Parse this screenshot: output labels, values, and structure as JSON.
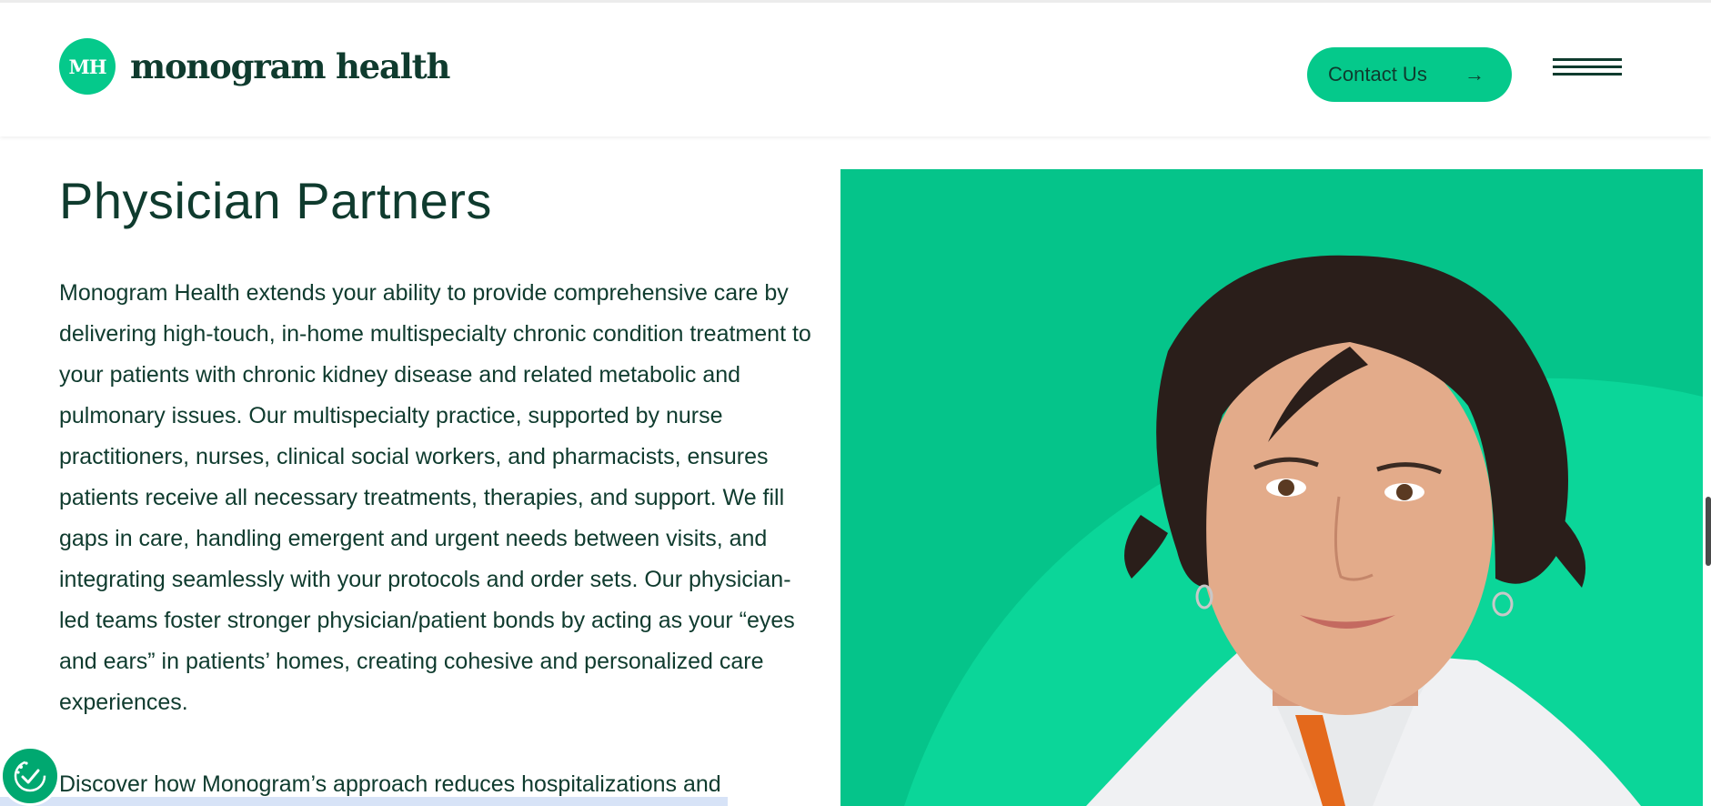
{
  "header": {
    "logo_mark": "MH",
    "logo_text": "monogram health",
    "contact_label": "Contact Us",
    "contact_icon": "arrow-right-icon",
    "menu_icon": "hamburger-menu-icon"
  },
  "main": {
    "title": "Physician Partners",
    "intro": "Monogram Health extends your ability to provide comprehensive care by delivering high-touch, in-home multispecialty chronic condition treatment to your patients with chronic kidney disease and related metabolic and pulmonary issues. Our multispecialty practice, supported by nurse practitioners, nurses, clinical social workers, and pharmacists, ensures patients receive all necessary treatments, therapies, and support. We fill gaps in care, handling emergent and urgent needs between visits, and integrating seamlessly with your protocols and order sets. Our physician-led teams foster stronger physician/patient bonds by acting as your “eyes and ears” in patients’ homes, creating cohesive and personalized care experiences.",
    "discover": "Discover how Monogram’s approach reduces hospitalizations and"
  },
  "colors": {
    "brand_green": "#05c98b",
    "dark_green": "#0f3b2e",
    "photo_bg": "#05c48a",
    "photo_arc": "#0bd699"
  },
  "icons": {
    "accessibility": "accessibility-icon"
  }
}
